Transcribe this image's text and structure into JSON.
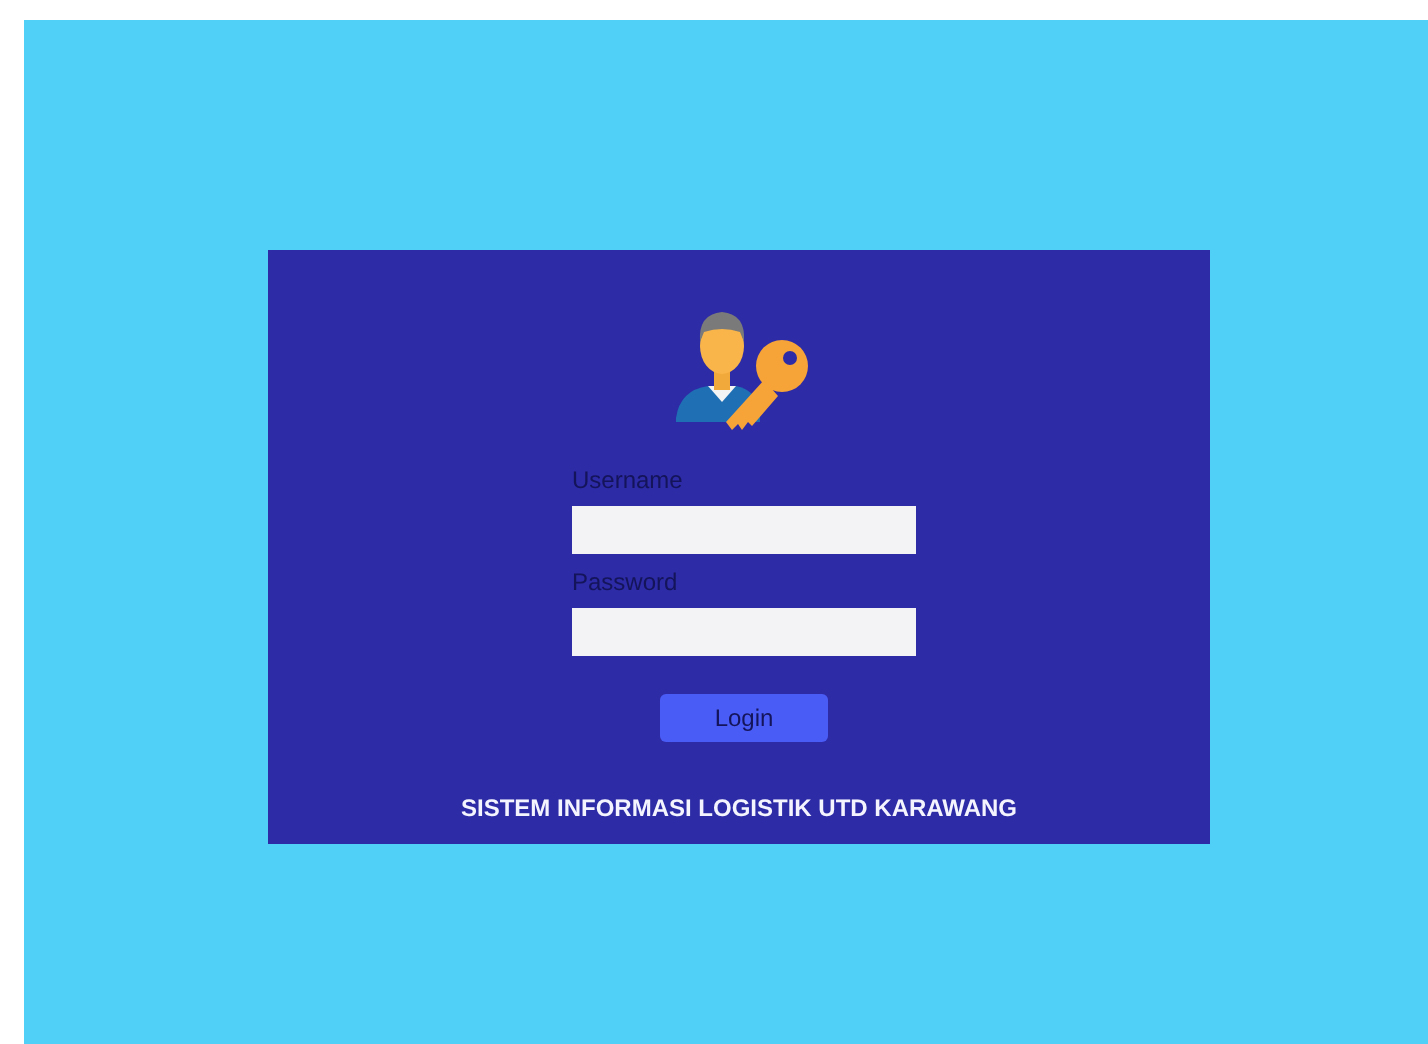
{
  "login_form": {
    "fields": [
      {
        "label": "Username"
      },
      {
        "label": "Password"
      }
    ],
    "button": "Login",
    "footer": "SISTEM INFORMASI LOGISTIK UTD KARAWANG"
  }
}
